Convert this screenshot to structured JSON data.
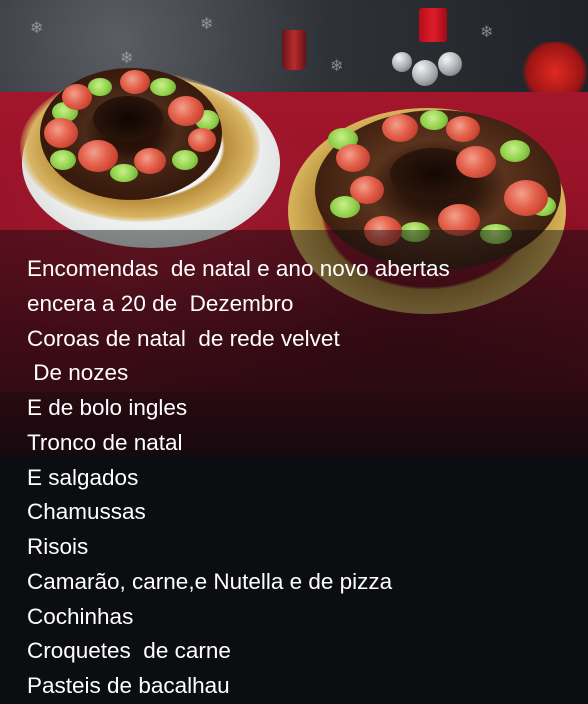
{
  "post": {
    "photo_alt": "christmas-wreath-cakes-photo",
    "caption_lines": [
      "Encomendas  de natal e ano novo abertas",
      "encera a 20 de  Dezembro",
      "Coroas de natal  de rede velvet",
      " De nozes",
      "E de bolo ingles",
      "Tronco de natal",
      "E salgados",
      "Chamussas",
      "Risois",
      "Camarão, carne,e Nutella e de pizza",
      "Cochinhas",
      "Croquetes  de carne",
      "Pasteis de bacalhau"
    ]
  },
  "colors": {
    "background": "#0b0d10",
    "text": "#ffffff",
    "tablecloth": "#a3162c"
  }
}
